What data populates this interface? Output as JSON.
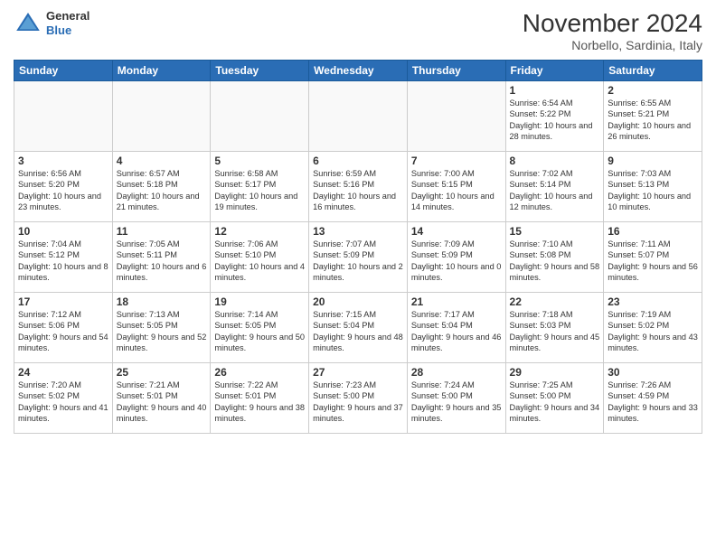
{
  "header": {
    "logo_line1": "General",
    "logo_line2": "Blue",
    "month": "November 2024",
    "location": "Norbello, Sardinia, Italy"
  },
  "weekdays": [
    "Sunday",
    "Monday",
    "Tuesday",
    "Wednesday",
    "Thursday",
    "Friday",
    "Saturday"
  ],
  "weeks": [
    [
      {
        "day": "",
        "detail": ""
      },
      {
        "day": "",
        "detail": ""
      },
      {
        "day": "",
        "detail": ""
      },
      {
        "day": "",
        "detail": ""
      },
      {
        "day": "",
        "detail": ""
      },
      {
        "day": "1",
        "detail": "Sunrise: 6:54 AM\nSunset: 5:22 PM\nDaylight: 10 hours\nand 28 minutes."
      },
      {
        "day": "2",
        "detail": "Sunrise: 6:55 AM\nSunset: 5:21 PM\nDaylight: 10 hours\nand 26 minutes."
      }
    ],
    [
      {
        "day": "3",
        "detail": "Sunrise: 6:56 AM\nSunset: 5:20 PM\nDaylight: 10 hours\nand 23 minutes."
      },
      {
        "day": "4",
        "detail": "Sunrise: 6:57 AM\nSunset: 5:18 PM\nDaylight: 10 hours\nand 21 minutes."
      },
      {
        "day": "5",
        "detail": "Sunrise: 6:58 AM\nSunset: 5:17 PM\nDaylight: 10 hours\nand 19 minutes."
      },
      {
        "day": "6",
        "detail": "Sunrise: 6:59 AM\nSunset: 5:16 PM\nDaylight: 10 hours\nand 16 minutes."
      },
      {
        "day": "7",
        "detail": "Sunrise: 7:00 AM\nSunset: 5:15 PM\nDaylight: 10 hours\nand 14 minutes."
      },
      {
        "day": "8",
        "detail": "Sunrise: 7:02 AM\nSunset: 5:14 PM\nDaylight: 10 hours\nand 12 minutes."
      },
      {
        "day": "9",
        "detail": "Sunrise: 7:03 AM\nSunset: 5:13 PM\nDaylight: 10 hours\nand 10 minutes."
      }
    ],
    [
      {
        "day": "10",
        "detail": "Sunrise: 7:04 AM\nSunset: 5:12 PM\nDaylight: 10 hours\nand 8 minutes."
      },
      {
        "day": "11",
        "detail": "Sunrise: 7:05 AM\nSunset: 5:11 PM\nDaylight: 10 hours\nand 6 minutes."
      },
      {
        "day": "12",
        "detail": "Sunrise: 7:06 AM\nSunset: 5:10 PM\nDaylight: 10 hours\nand 4 minutes."
      },
      {
        "day": "13",
        "detail": "Sunrise: 7:07 AM\nSunset: 5:09 PM\nDaylight: 10 hours\nand 2 minutes."
      },
      {
        "day": "14",
        "detail": "Sunrise: 7:09 AM\nSunset: 5:09 PM\nDaylight: 10 hours\nand 0 minutes."
      },
      {
        "day": "15",
        "detail": "Sunrise: 7:10 AM\nSunset: 5:08 PM\nDaylight: 9 hours\nand 58 minutes."
      },
      {
        "day": "16",
        "detail": "Sunrise: 7:11 AM\nSunset: 5:07 PM\nDaylight: 9 hours\nand 56 minutes."
      }
    ],
    [
      {
        "day": "17",
        "detail": "Sunrise: 7:12 AM\nSunset: 5:06 PM\nDaylight: 9 hours\nand 54 minutes."
      },
      {
        "day": "18",
        "detail": "Sunrise: 7:13 AM\nSunset: 5:05 PM\nDaylight: 9 hours\nand 52 minutes."
      },
      {
        "day": "19",
        "detail": "Sunrise: 7:14 AM\nSunset: 5:05 PM\nDaylight: 9 hours\nand 50 minutes."
      },
      {
        "day": "20",
        "detail": "Sunrise: 7:15 AM\nSunset: 5:04 PM\nDaylight: 9 hours\nand 48 minutes."
      },
      {
        "day": "21",
        "detail": "Sunrise: 7:17 AM\nSunset: 5:04 PM\nDaylight: 9 hours\nand 46 minutes."
      },
      {
        "day": "22",
        "detail": "Sunrise: 7:18 AM\nSunset: 5:03 PM\nDaylight: 9 hours\nand 45 minutes."
      },
      {
        "day": "23",
        "detail": "Sunrise: 7:19 AM\nSunset: 5:02 PM\nDaylight: 9 hours\nand 43 minutes."
      }
    ],
    [
      {
        "day": "24",
        "detail": "Sunrise: 7:20 AM\nSunset: 5:02 PM\nDaylight: 9 hours\nand 41 minutes."
      },
      {
        "day": "25",
        "detail": "Sunrise: 7:21 AM\nSunset: 5:01 PM\nDaylight: 9 hours\nand 40 minutes."
      },
      {
        "day": "26",
        "detail": "Sunrise: 7:22 AM\nSunset: 5:01 PM\nDaylight: 9 hours\nand 38 minutes."
      },
      {
        "day": "27",
        "detail": "Sunrise: 7:23 AM\nSunset: 5:00 PM\nDaylight: 9 hours\nand 37 minutes."
      },
      {
        "day": "28",
        "detail": "Sunrise: 7:24 AM\nSunset: 5:00 PM\nDaylight: 9 hours\nand 35 minutes."
      },
      {
        "day": "29",
        "detail": "Sunrise: 7:25 AM\nSunset: 5:00 PM\nDaylight: 9 hours\nand 34 minutes."
      },
      {
        "day": "30",
        "detail": "Sunrise: 7:26 AM\nSunset: 4:59 PM\nDaylight: 9 hours\nand 33 minutes."
      }
    ]
  ]
}
